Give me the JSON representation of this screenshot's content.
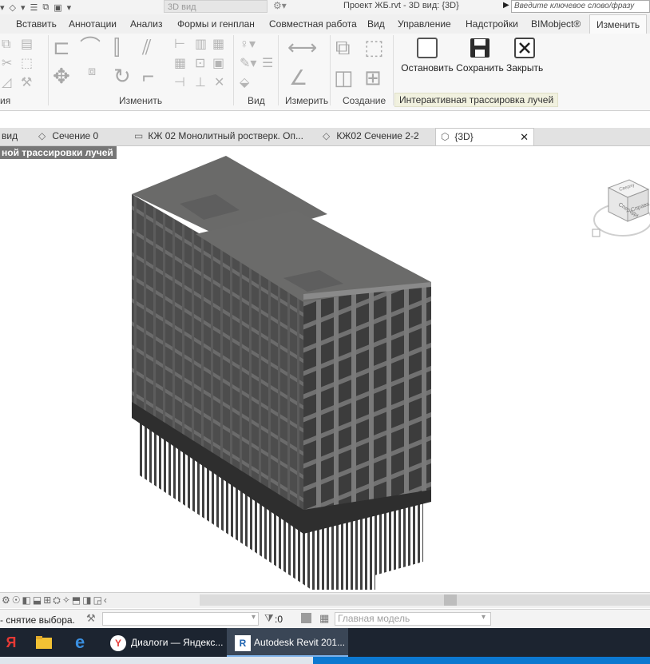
{
  "title_bar": {
    "view_combo": "3D вид",
    "document_title": "Проект ЖБ.rvt - 3D вид: {3D}",
    "search_placeholder": "Введите ключевое слово/фразу"
  },
  "ribbon_tabs": [
    {
      "label": "Вставить",
      "active": false
    },
    {
      "label": "Аннотации",
      "active": false
    },
    {
      "label": "Анализ",
      "active": false
    },
    {
      "label": "Формы и генплан",
      "active": false
    },
    {
      "label": "Совместная работа",
      "active": false
    },
    {
      "label": "Вид",
      "active": false
    },
    {
      "label": "Управление",
      "active": false
    },
    {
      "label": "Надстройки",
      "active": false
    },
    {
      "label": "BIMobject®",
      "active": false
    },
    {
      "label": "Изменить",
      "active": true
    }
  ],
  "ribbon_panels": {
    "partial": "ия",
    "modify": "Изменить",
    "view": "Вид",
    "measure": "Измерить",
    "create": "Создание"
  },
  "raytrace_buttons": {
    "stop": "Остановить",
    "save": "Сохранить",
    "close": "Закрыть",
    "panel_label": "Интерактивная трассировка лучей"
  },
  "view_tabs": [
    {
      "label": "вид",
      "icon": "partial",
      "active": false
    },
    {
      "label": "Сечение 0",
      "icon": "section-icon",
      "active": false
    },
    {
      "label": "КЖ 02 Монолитный ростверк. Оп...",
      "icon": "sheet-icon",
      "active": false
    },
    {
      "label": "КЖ02 Сечение 2-2",
      "icon": "section-icon",
      "active": false
    },
    {
      "label": "{3D}",
      "icon": "3d-view-icon",
      "active": true
    }
  ],
  "view_tab_close": "✕",
  "canvas": {
    "render_label": "ной трассировки лучей",
    "viewcube": {
      "left": "Спереди",
      "right": "Справа",
      "top": "Сверху"
    }
  },
  "status_bar": {
    "text": "- снятие выбора.",
    "filter_count": ":0",
    "model": "Главная модель"
  },
  "taskbar": {
    "items": [
      {
        "label": "Я",
        "icon": "yandex-icon"
      },
      {
        "label": "",
        "icon": "file-explorer-icon"
      },
      {
        "label": "",
        "icon": "edge-icon"
      },
      {
        "label": "Диалоги — Яндекс...",
        "icon": "yandex-browser-icon"
      },
      {
        "label": "Autodesk Revit 201...",
        "icon": "revit-icon"
      }
    ]
  },
  "colors": {
    "building": "#5a5a5a",
    "slab_top": "#6a6a69",
    "accent_blue": "#0c78d0",
    "taskbar": "#1c2430"
  }
}
